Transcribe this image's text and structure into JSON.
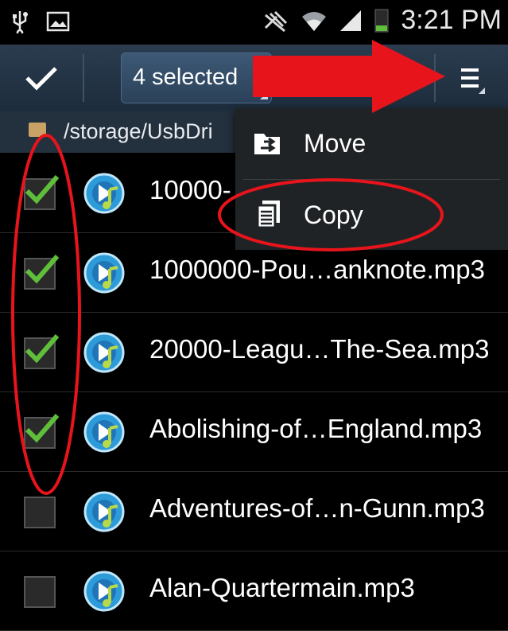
{
  "status_bar": {
    "time": "3:21 PM",
    "icons": [
      "usb-icon",
      "image-icon",
      "mute-icon",
      "wifi-icon",
      "signal-icon",
      "battery-icon"
    ]
  },
  "action_bar": {
    "selection_label": "4 selected",
    "done_icon": "check-icon",
    "overflow_icon": "menu-icon"
  },
  "path": {
    "text": "/storage/UsbDri"
  },
  "files": [
    {
      "name": "10000-",
      "checked": true
    },
    {
      "name": "1000000-Pou…anknote.mp3",
      "checked": true
    },
    {
      "name": "20000-Leagu…The-Sea.mp3",
      "checked": true
    },
    {
      "name": "Abolishing-of…England.mp3",
      "checked": true
    },
    {
      "name": "Adventures-of…n-Gunn.mp3",
      "checked": false
    },
    {
      "name": "Alan-Quartermain.mp3",
      "checked": false
    }
  ],
  "popup_menu": {
    "items": [
      {
        "label": "Move",
        "icon": "move-icon"
      },
      {
        "label": "Copy",
        "icon": "copy-icon"
      }
    ]
  },
  "colors": {
    "check_green": "#5fbf3a",
    "annotation_red": "#e8141c",
    "action_bar": "#24364a"
  }
}
